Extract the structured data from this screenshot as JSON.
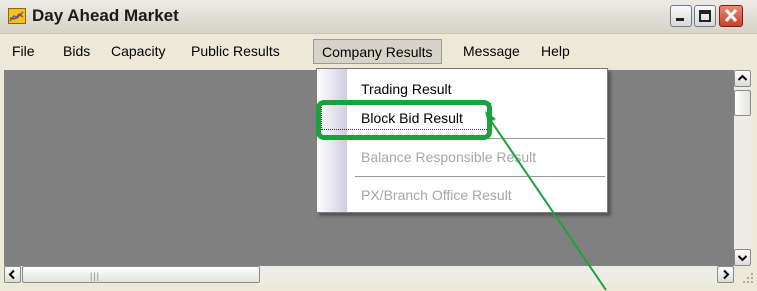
{
  "window": {
    "title": "Day Ahead Market"
  },
  "menu": {
    "items": [
      "File",
      "Bids",
      "Capacity",
      "Public Results",
      "Company Results",
      "Message",
      "Help"
    ],
    "active": "Company Results"
  },
  "dropdown": {
    "items": [
      {
        "label": "Trading Result",
        "enabled": true
      },
      {
        "label": "Block Bid Result",
        "enabled": true,
        "focused": true
      },
      {
        "label": "Balance Responsible Result",
        "enabled": false
      },
      {
        "label": "PX/Branch Office Result",
        "enabled": false
      }
    ]
  },
  "icons": {
    "app": "chart-icon",
    "minimize": "minimize-icon",
    "maximize": "maximize-icon",
    "close": "close-icon",
    "scroll_up": "arrow-up-icon",
    "scroll_down": "arrow-down-icon",
    "scroll_left": "arrow-left-icon",
    "scroll_right": "arrow-right-icon"
  },
  "colors": {
    "highlight": "#1aa33c",
    "close_button": "#c8412c",
    "client_area": "#808080"
  }
}
